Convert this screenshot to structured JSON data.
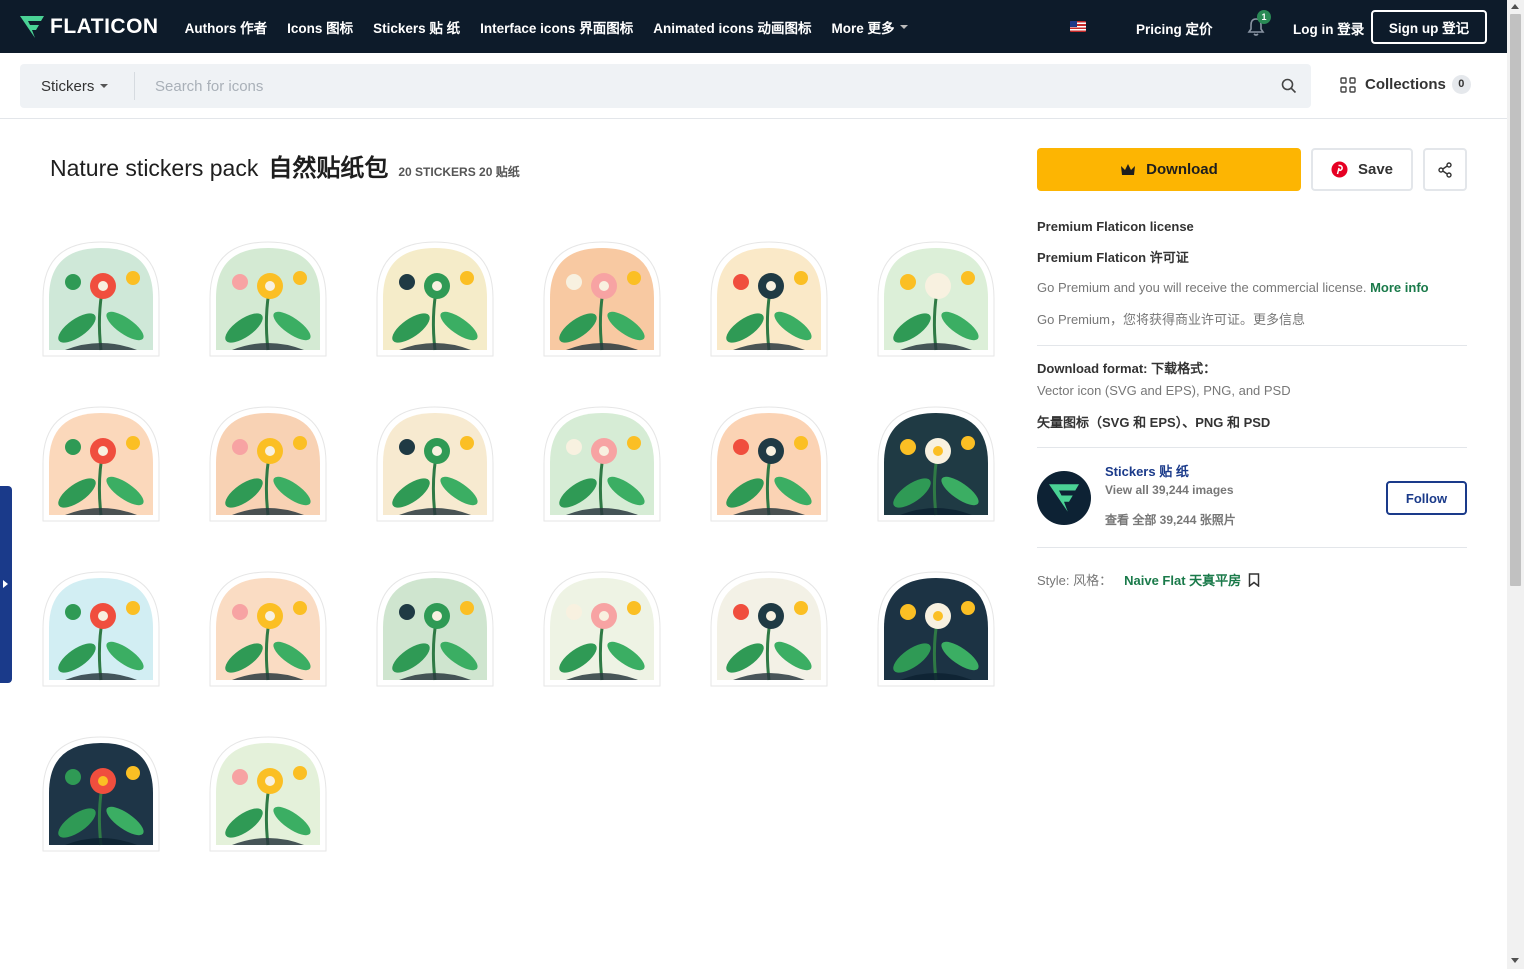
{
  "brand": {
    "logo_text": "FLATICON"
  },
  "nav": {
    "items": [
      "Authors 作者",
      "Icons 图标",
      "Stickers 贴 纸",
      "Interface icons 界面图标",
      "Animated icons 动画图标"
    ],
    "more": "More 更多",
    "pricing": "Pricing 定价",
    "notifications_count": "1",
    "login": "Log in 登录",
    "signup": "Sign up 登记"
  },
  "search": {
    "type": "Stickers",
    "placeholder": "Search for icons",
    "collections_label": "Collections",
    "collections_count": "0"
  },
  "pack": {
    "title_en": "Nature stickers pack",
    "title_cn": "自然贴纸包",
    "count": "20 STICKERS 20 贴纸"
  },
  "stickers": [
    {
      "name": "hummingbird-flowers-sticker",
      "bg": "#cfe8d8"
    },
    {
      "name": "bee-leaves-sticker",
      "bg": "#d4ead3"
    },
    {
      "name": "dragonfly-pond-sticker",
      "bg": "#f5ecc9"
    },
    {
      "name": "hamster-mushrooms-sticker",
      "bg": "#f8c9a2"
    },
    {
      "name": "bird-cactus-sticker",
      "bg": "#fae9c8"
    },
    {
      "name": "bee-daisies-sticker",
      "bg": "#dcefd8"
    },
    {
      "name": "butterfly-flowers-sticker",
      "bg": "#fbd8bb"
    },
    {
      "name": "bird-branch-sticker",
      "bg": "#f8d2b4"
    },
    {
      "name": "red-flowers-sticker",
      "bg": "#f7ead0"
    },
    {
      "name": "butterfly-plant-sticker",
      "bg": "#d6ecd5"
    },
    {
      "name": "snail-mushroom-sticker",
      "bg": "#fbd3b4"
    },
    {
      "name": "duck-pond-sticker",
      "bg": "#1f3a44"
    },
    {
      "name": "ladybugs-flowers-sticker",
      "bg": "#d2eef3"
    },
    {
      "name": "caterpillar-daisy-sticker",
      "bg": "#fadcc3"
    },
    {
      "name": "moths-plants-sticker",
      "bg": "#cfe5cf"
    },
    {
      "name": "whale-sticker",
      "bg": "#eef3e4"
    },
    {
      "name": "rose-flowers-sticker",
      "bg": "#f3f1e6"
    },
    {
      "name": "night-flowers-sticker",
      "bg": "#1c3344"
    },
    {
      "name": "night-moths-sticker",
      "bg": "#1e3547"
    },
    {
      "name": "spring-bouquet-sticker",
      "bg": "#e4f1da"
    }
  ],
  "panel": {
    "download": "Download",
    "save": "Save",
    "license_title": "Premium Flaticon license",
    "license_title_cn": "Premium Flaticon 许可证",
    "license_text": "Go Premium and you will receive the commercial license.",
    "more_info": "More info",
    "license_text_cn": "Go Premium，您将获得商业许可证。更多信息",
    "format_title": "Download format: 下载格式：",
    "format_text": "Vector icon (SVG and EPS), PNG, and PSD",
    "format_text_cn": "矢量图标（SVG 和 EPS）、PNG 和 PSD",
    "author_name": "Stickers 贴 纸",
    "author_count": "View all 39,244 images",
    "author_count_cn": "查看 全部 39,244 张照片",
    "follow": "Follow",
    "style_label": "Style: 风格：",
    "style_value": "Naive Flat 天真平房"
  },
  "colors": {
    "nav_bg": "#0d1b2a",
    "download_bg": "#fdb502",
    "accent_green": "#1a7a4a",
    "accent_blue": "#1a3a8a"
  }
}
